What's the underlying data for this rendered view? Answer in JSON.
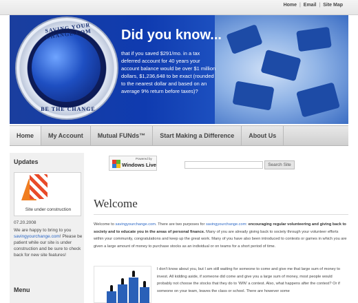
{
  "top_links": {
    "home": "Home",
    "email": "Email",
    "sitemap": "Site Map",
    "sep": "|"
  },
  "banner": {
    "logo_top_text": "SAVING YOUR CHANGE.COM",
    "logo_bottom_text": "BE THE CHANGE",
    "headline": "Did you know...",
    "body": "that if you saved $291/mo. in a tax deferred account for 40 years your account balance would be over $1 million dollars, $1,236,648 to be exact (rounded to the nearest dollar and based on an average 9% return before taxes)?"
  },
  "nav": {
    "items": [
      "Home",
      "My Account",
      "Mutual FUNds™",
      "Start Making a Difference",
      "About Us"
    ]
  },
  "sidebar": {
    "updates_heading": "Updates",
    "thumb_caption": "Site under construction",
    "date": "07.20.2008",
    "text_before": "We are happy to bring to you ",
    "text_link": "savingyourchange.com",
    "text_after": "! Please be patient while our site is under construction and be sure to check back for new site features!",
    "menu_heading": "Menu"
  },
  "windows_live": {
    "powered": "Powered by",
    "name": "Windows Live"
  },
  "search": {
    "button_label": "Search Site",
    "placeholder": ""
  },
  "main": {
    "title": "Welcome",
    "p1_a": "Welcome to ",
    "p1_link1": "savingyourchange.com",
    "p1_b": ".  There are two purposes for ",
    "p1_link2": "savingyourchange.com",
    "p1_c": ": ",
    "p1_bold": "encouraging regular volunteering and giving back to society and to educate you in the areas of personal finance.",
    "p1_d": "  Many of you are already giving back to society through your volunteer efforts within your community, congratulations and keep up the great work.  Many of you have also been introduced to contests or games in which you are given a large amount of money to purchase stocks as an individual or on teams for a short period of time.",
    "p2": "I don't know about you, but I am still waiting for someone to come and give me that large sum of money to invest.  All kidding aside, if someone did come and give you a large sum of money, most people would probably not choose the stocks that they do to 'WIN' a contest.  Also, what happens after the contest?  Or if someone on your team, leaves the class or school.  There are however some"
  }
}
